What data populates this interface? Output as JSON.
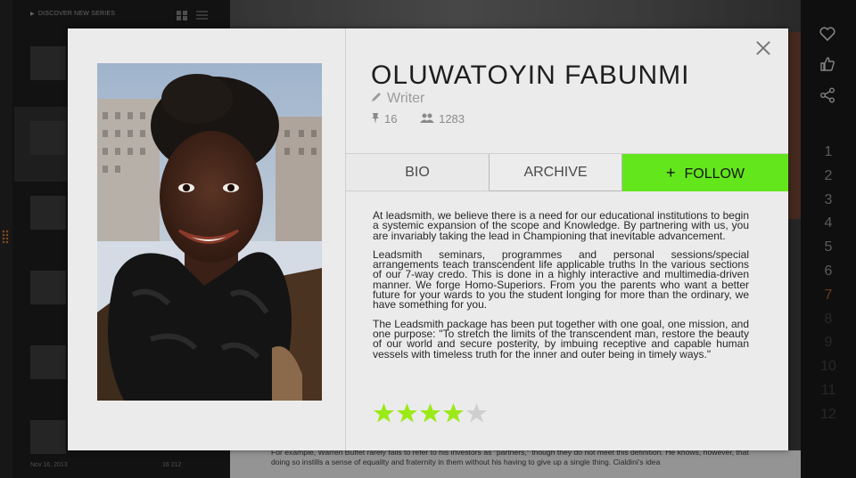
{
  "background": {
    "sidebar": {
      "discover_label": "DISCOVER NEW SERIES",
      "date_label": "Nov 16, 2013",
      "stats_label": "16   212"
    },
    "article_text": "For example, Warren Buffet rarely fails to refer to his investors as \"partners,\" though they do not meet this definition. He knows, however, that doing so instills a sense of equality and fraternity in them without his having to give up a single thing. Cialdini's idea"
  },
  "rightbar": {
    "icons": [
      "heart-icon",
      "thumbs-up-icon",
      "share-icon"
    ],
    "pages": [
      "1",
      "2",
      "3",
      "4",
      "5",
      "6",
      "7",
      "8",
      "9",
      "10",
      "11",
      "12"
    ],
    "active_page": "7"
  },
  "modal": {
    "name": "OLUWATOYIN FABUNMI",
    "role": "Writer",
    "pins": "16",
    "followers": "1283",
    "tabs": {
      "bio": "BIO",
      "archive": "ARCHIVE",
      "follow": "FOLLOW"
    },
    "bio_paragraphs": [
      "At leadsmith, we believe there is a need for our educational institutions  to begin a systemic expansion of the scope and Knowledge. By partnering with us, you are invariably taking the lead in Championing that inevitable advancement.",
      "Leadsmith seminars, programmes and personal sessions/special arrangements teach transcendent life applicable truths In the various sections of our 7-way credo. This is done in a highly interactive and multimedia-driven manner. We forge Homo-Superiors. From you the parents who want a better future for your wards to you the student longing for more than the ordinary, we have something for you.",
      "The Leadsmith package has been put together with one goal, one mission, and one purpose: \"To stretch the limits of the transcendent man, restore the beauty of our world and secure posterity, by imbuing receptive and capable human vessels with timeless truth for the inner and outer being in timely ways.\""
    ],
    "rating": 4,
    "rating_max": 5,
    "colors": {
      "follow_bg": "#64e61c",
      "star_on": "#9bea17",
      "star_off": "#cfcfcf"
    }
  }
}
